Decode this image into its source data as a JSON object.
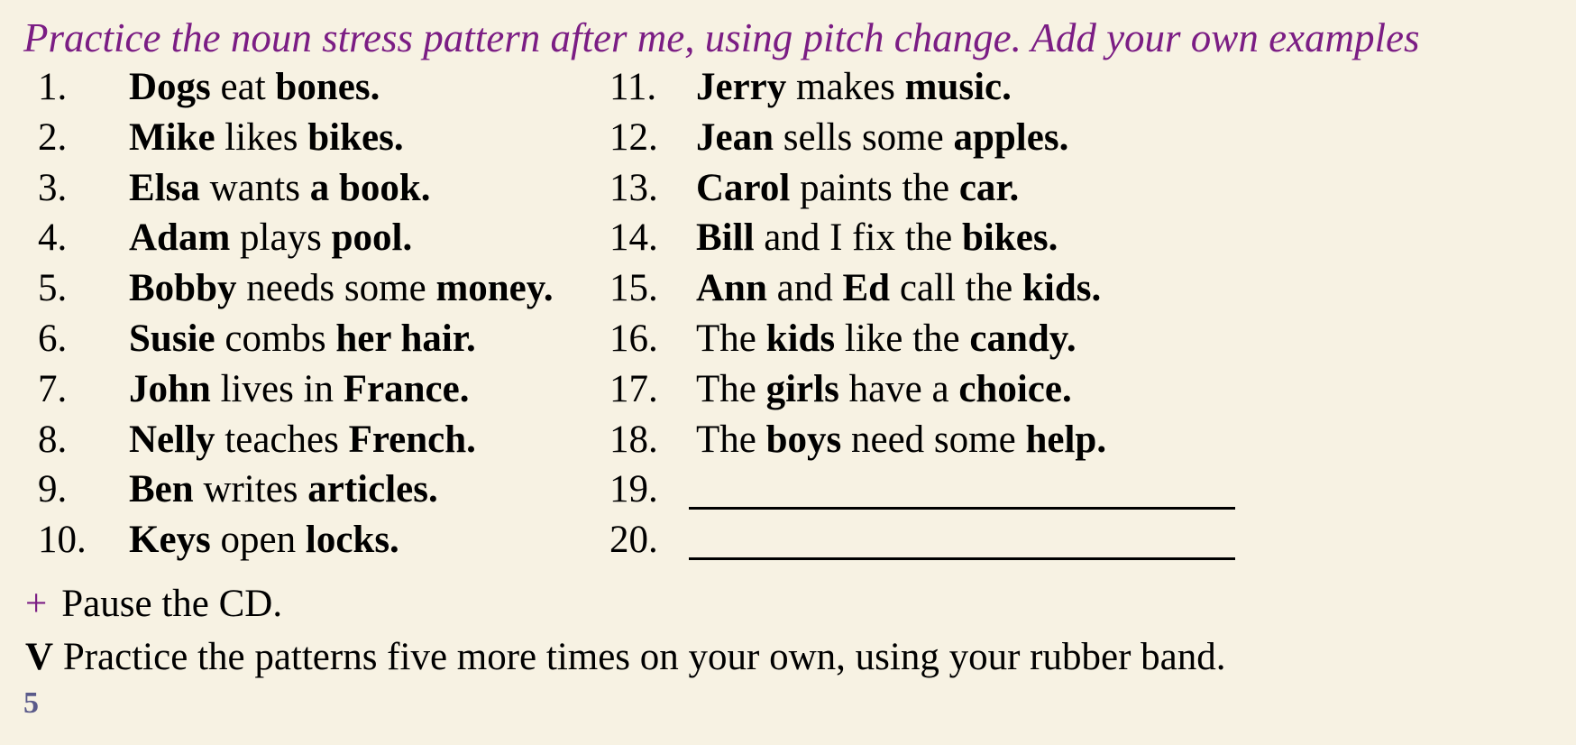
{
  "heading": "Practice the noun stress pattern after me, using pitch change. Add your own examples",
  "left_column": [
    {
      "number": "1.",
      "parts": [
        {
          "text": "Dogs",
          "bold": true
        },
        {
          "text": " eat ",
          "bold": false
        },
        {
          "text": "bones.",
          "bold": true
        }
      ]
    },
    {
      "number": "2.",
      "parts": [
        {
          "text": "Mike",
          "bold": true
        },
        {
          "text": " likes ",
          "bold": false
        },
        {
          "text": "bikes.",
          "bold": true
        }
      ]
    },
    {
      "number": "3.",
      "parts": [
        {
          "text": "Elsa",
          "bold": true
        },
        {
          "text": " wants ",
          "bold": false
        },
        {
          "text": "a book.",
          "bold": true
        }
      ]
    },
    {
      "number": "4.",
      "parts": [
        {
          "text": "Adam",
          "bold": true
        },
        {
          "text": " plays ",
          "bold": false
        },
        {
          "text": "pool.",
          "bold": true
        }
      ]
    },
    {
      "number": "5.",
      "parts": [
        {
          "text": "Bobby",
          "bold": true
        },
        {
          "text": " needs some ",
          "bold": false
        },
        {
          "text": "money.",
          "bold": true
        }
      ]
    },
    {
      "number": "6.",
      "parts": [
        {
          "text": "Susie",
          "bold": true
        },
        {
          "text": " combs ",
          "bold": false
        },
        {
          "text": "her hair.",
          "bold": true
        }
      ]
    },
    {
      "number": "7.",
      "parts": [
        {
          "text": "John",
          "bold": true
        },
        {
          "text": " lives in ",
          "bold": false
        },
        {
          "text": "France.",
          "bold": true
        }
      ]
    },
    {
      "number": "8.",
      "parts": [
        {
          "text": "Nelly",
          "bold": true
        },
        {
          "text": " teaches ",
          "bold": false
        },
        {
          "text": "French.",
          "bold": true
        }
      ]
    },
    {
      "number": "9.",
      "parts": [
        {
          "text": "Ben",
          "bold": true
        },
        {
          "text": " writes ",
          "bold": false
        },
        {
          "text": "articles.",
          "bold": true
        }
      ]
    },
    {
      "number": "10.",
      "parts": [
        {
          "text": "Keys",
          "bold": true
        },
        {
          "text": " open ",
          "bold": false
        },
        {
          "text": "locks.",
          "bold": true
        }
      ]
    }
  ],
  "right_column": [
    {
      "number": "11.",
      "parts": [
        {
          "text": "Jerry",
          "bold": true
        },
        {
          "text": " makes ",
          "bold": false
        },
        {
          "text": "music.",
          "bold": true
        }
      ]
    },
    {
      "number": "12.",
      "parts": [
        {
          "text": "Jean",
          "bold": true
        },
        {
          "text": " sells some ",
          "bold": false
        },
        {
          "text": "apples.",
          "bold": true
        }
      ]
    },
    {
      "number": "13.",
      "parts": [
        {
          "text": "Carol",
          "bold": true
        },
        {
          "text": " paints the ",
          "bold": false
        },
        {
          "text": "car.",
          "bold": true
        }
      ]
    },
    {
      "number": "14.",
      "parts": [
        {
          "text": "Bill",
          "bold": true
        },
        {
          "text": " and I fix the ",
          "bold": false
        },
        {
          "text": "bikes.",
          "bold": true
        }
      ]
    },
    {
      "number": "15.",
      "parts": [
        {
          "text": "Ann",
          "bold": true
        },
        {
          "text": " and ",
          "bold": false
        },
        {
          "text": "Ed",
          "bold": true
        },
        {
          "text": " call the ",
          "bold": false
        },
        {
          "text": "kids.",
          "bold": true
        }
      ]
    },
    {
      "number": "16.",
      "parts": [
        {
          "text": "The ",
          "bold": false
        },
        {
          "text": "kids",
          "bold": true
        },
        {
          "text": " like the ",
          "bold": false
        },
        {
          "text": "candy.",
          "bold": true
        }
      ]
    },
    {
      "number": "17.",
      "parts": [
        {
          "text": "The ",
          "bold": false
        },
        {
          "text": "girls",
          "bold": true
        },
        {
          "text": " have a ",
          "bold": false
        },
        {
          "text": "choice.",
          "bold": true
        }
      ]
    },
    {
      "number": "18.",
      "parts": [
        {
          "text": "The ",
          "bold": false
        },
        {
          "text": "boys",
          "bold": true
        },
        {
          "text": " need some ",
          "bold": false
        },
        {
          "text": "help.",
          "bold": true
        }
      ]
    },
    {
      "number": "19.",
      "blank": true
    },
    {
      "number": "20.",
      "blank": true
    }
  ],
  "pause_line": {
    "icon": "plus-icon",
    "text": "Pause the CD."
  },
  "practice_line": {
    "marker": "V",
    "text": " Practice the patterns five more times on your own, using your rubber band."
  },
  "page_number": "5",
  "colors": {
    "heading": "#7b1d84",
    "background": "#f7f2e3",
    "page_number": "#5a5a8a"
  }
}
